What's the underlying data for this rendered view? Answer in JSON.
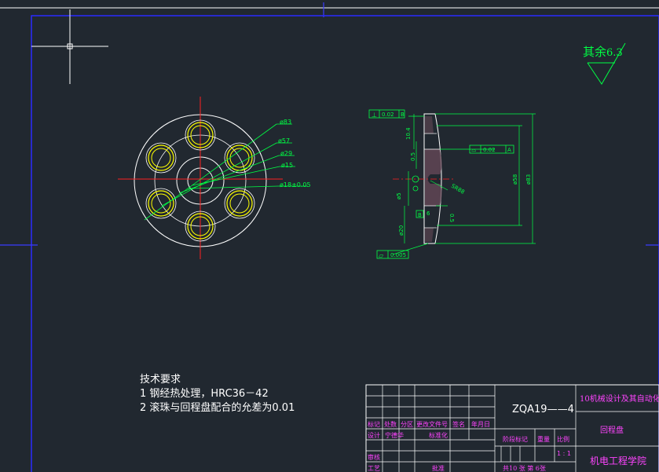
{
  "roughness": {
    "label": "其余",
    "value": "6.3"
  },
  "front_view": {
    "dims": [
      "ø83",
      "ø57",
      "ø29",
      "ø15",
      "ø18±0.05"
    ]
  },
  "side_view": {
    "perp_tol": {
      "symbol": "⊥",
      "value": "0.02",
      "datum": "B"
    },
    "profile_tol": {
      "symbol": "⌓",
      "value": "0.02",
      "datum": "A"
    },
    "flat_tol": {
      "symbol": "▱",
      "value": "0.005"
    },
    "dims": {
      "d10_4": "10.4",
      "d0_5a": "0.5",
      "d5": "ø5",
      "d20": "ø20",
      "d0_5b": "0.5",
      "d6": "6",
      "d58": "ø58",
      "d83": "ø83",
      "s888": "SR88",
      "datum_b": "B"
    }
  },
  "notes": {
    "title": "技术要求",
    "line1": "1 钢经热处理，HRC36－42",
    "line2": "2 滚珠与回程盘配合的允差为0.01"
  },
  "title_block": {
    "drawing_no": "ZQA19——4",
    "top_right": "10机械设计及其自动化",
    "part_name": "回程盘",
    "school": "机电工程学院",
    "row_headers": [
      "标记",
      "处数",
      "分区",
      "更改文件号",
      "签名",
      "年月日"
    ],
    "designer_row": [
      "设计",
      "宁德华",
      "",
      "标准化",
      "",
      ""
    ],
    "stage_label": "阶段标记",
    "weight_label": "重量",
    "scale_label": "比例",
    "scale_value": "1 : 1",
    "review": "审核",
    "process": "工艺",
    "approve": "批准",
    "sheets": "共10 张  第 6张"
  }
}
